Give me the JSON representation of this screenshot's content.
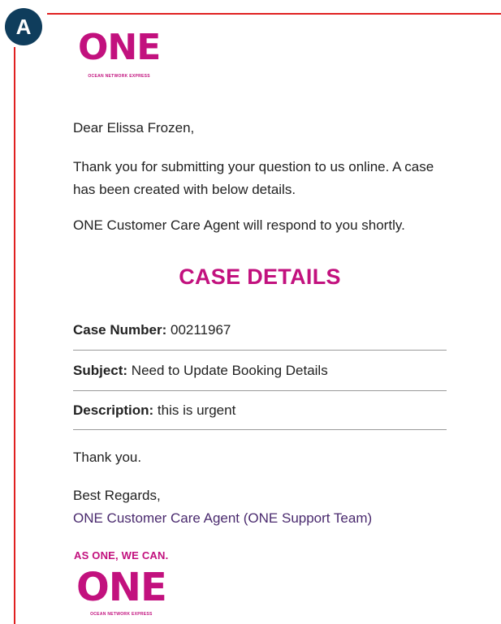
{
  "marker": {
    "label": "A"
  },
  "top_cut_text": "…",
  "header_logo": {
    "word": "ONE",
    "subtitle": "OCEAN NETWORK EXPRESS"
  },
  "email": {
    "greeting": "Dear Elissa Frozen,",
    "thanks": "Thank you for submitting your question to us online. A case has been created with below details.",
    "respond": "ONE Customer Care Agent will respond to you shortly.",
    "case_heading": "CASE DETAILS",
    "details": [
      {
        "label": "Case Number:",
        "value": " 00211967"
      },
      {
        "label": "Subject:",
        "value": " Need to Update Booking Details"
      },
      {
        "label": "Description:",
        "value": " this is urgent"
      }
    ],
    "thank_you": "Thank you.",
    "regards": "Best Regards,",
    "signature": "ONE Customer Care Agent (ONE Support Team)"
  },
  "footer_logo": {
    "slogan": "AS ONE, WE CAN.",
    "word": "ONE",
    "subtitle": "OCEAN NETWORK EXPRESS"
  },
  "colors": {
    "brand": "#c2117e",
    "accent_rule": "#e02020",
    "marker_bg": "#0f3d5c",
    "signature": "#4a2a6e"
  }
}
